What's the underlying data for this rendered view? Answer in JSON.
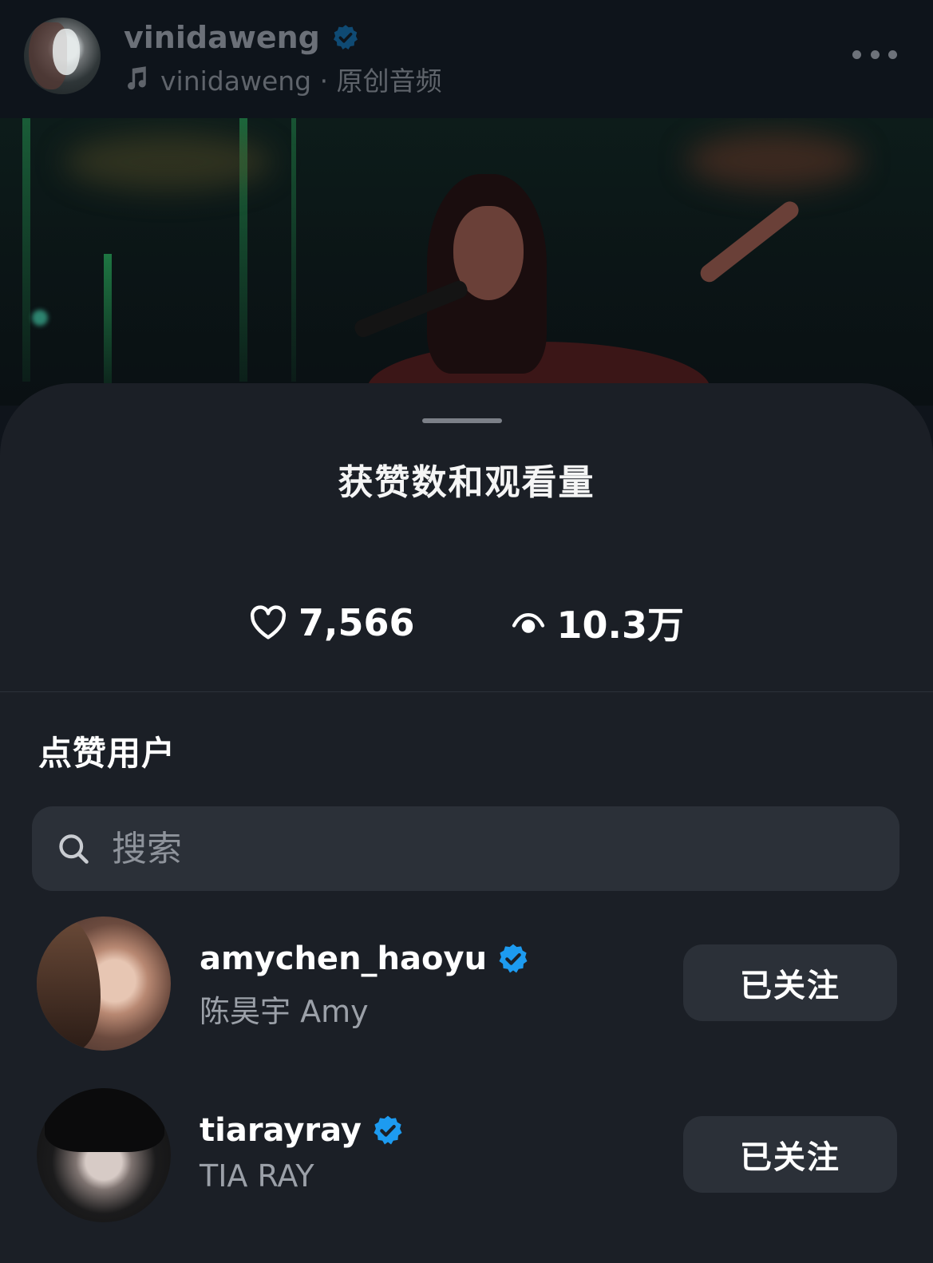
{
  "post_header": {
    "username": "vinidaweng",
    "audio_label": "vinidaweng · 原创音频"
  },
  "sheet": {
    "title": "获赞数和观看量",
    "likes_count": "7,566",
    "views_count": "10.3万"
  },
  "likers": {
    "section_title": "点赞用户",
    "search_placeholder": "搜索",
    "users": [
      {
        "username": "amychen_haoyu",
        "display_name": "陈昊宇 Amy",
        "verified": true,
        "follow_label": "已关注"
      },
      {
        "username": "tiarayray",
        "display_name": "TIA RAY",
        "verified": true,
        "follow_label": "已关注"
      }
    ]
  },
  "colors": {
    "sheet_bg": "#1b1f26",
    "button_bg": "#2b3038",
    "verified_blue": "#1d9bf0",
    "secondary_text": "#9ba0a8"
  },
  "icons": {
    "likes": "heart-outline-icon",
    "views": "eye-icon",
    "search": "search-icon",
    "verified": "verified-badge-icon",
    "audio": "music-note-icon",
    "more": "more-horizontal-icon"
  }
}
